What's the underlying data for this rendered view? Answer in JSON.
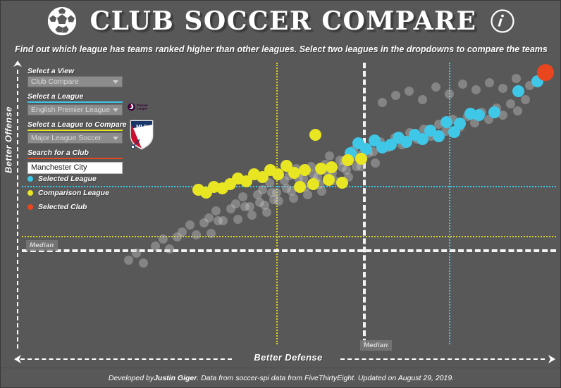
{
  "header": {
    "title": "CLUB SOCCER COMPARE",
    "ball_icon": "soccer-ball-icon",
    "info_icon": "info-icon",
    "subtitle": "Find out which league has teams ranked higher than other leagues. Select two leagues in the dropdowns to compare the teams"
  },
  "controls": {
    "view": {
      "label": "Select a View",
      "value": "Club Compare",
      "underline": "none"
    },
    "league": {
      "label": "Select a League",
      "value": "English Premier League",
      "underline": "#3fc7e8"
    },
    "compare": {
      "label": "Select a League to Compare",
      "value": "Major League Soccer",
      "underline": "#e8e523"
    },
    "search": {
      "label": "Search for a Club",
      "value": "Manchester City",
      "placeholder": "Search for a Club",
      "underline": "#e8461f"
    }
  },
  "logos": {
    "league_logo": "premier-league-logo",
    "compare_logo": "mls-logo"
  },
  "legend": {
    "items": [
      {
        "label": "Selected League",
        "color": "#3fc7e8"
      },
      {
        "label": "Comparison League",
        "color": "#e8e523"
      },
      {
        "label": "Selected Club",
        "color": "#e8461f"
      }
    ]
  },
  "axes": {
    "y_label": "Better Offense",
    "x_label": "Better Defense",
    "y_median_tag": "Median",
    "x_median_tag": "Median"
  },
  "footer": {
    "prefix": "Developed by ",
    "author": "Justin Giger",
    "suffix": ". Data from soccer-spi data from FiveThirtyEight. Updated on August 29, 2019."
  },
  "chart_data": {
    "type": "scatter",
    "title": "CLUB SOCCER COMPARE",
    "xlabel": "Better Defense",
    "ylabel": "Better Offense",
    "xlim": [
      0,
      100
    ],
    "ylim": [
      0,
      100
    ],
    "grid": false,
    "legend_position": "left",
    "medians": {
      "overall_x": 63.8,
      "overall_y": 64.5,
      "selected_league_x": 80.0,
      "selected_league_y": 78.5,
      "comparison_league_x": 47.6,
      "comparison_league_y": 61.0
    },
    "series": [
      {
        "name": "All Clubs",
        "color": "#c8c8c8",
        "points": [
          [
            57.6,
            66.8
          ],
          [
            60.3,
            65.2
          ],
          [
            62.1,
            69.0
          ],
          [
            63.5,
            67.5
          ],
          [
            64.2,
            70.2
          ],
          [
            65.8,
            68.4
          ],
          [
            67.1,
            72.0
          ],
          [
            68.5,
            69.8
          ],
          [
            69.9,
            73.5
          ],
          [
            71.2,
            71.0
          ],
          [
            72.6,
            75.2
          ],
          [
            73.9,
            72.8
          ],
          [
            75.3,
            76.5
          ],
          [
            76.6,
            74.0
          ],
          [
            78.0,
            78.2
          ],
          [
            79.3,
            75.6
          ],
          [
            80.7,
            79.8
          ],
          [
            82.0,
            77.2
          ],
          [
            83.4,
            81.0
          ],
          [
            84.7,
            78.6
          ],
          [
            86.1,
            82.5
          ],
          [
            87.4,
            80.0
          ],
          [
            88.8,
            84.0
          ],
          [
            90.1,
            81.5
          ],
          [
            91.5,
            85.5
          ],
          [
            92.8,
            83.0
          ],
          [
            94.2,
            87.0
          ],
          [
            50.0,
            60.0
          ],
          [
            51.4,
            62.5
          ],
          [
            52.7,
            58.8
          ],
          [
            54.1,
            63.2
          ],
          [
            55.4,
            59.5
          ],
          [
            56.8,
            64.0
          ],
          [
            58.1,
            60.8
          ],
          [
            59.5,
            65.5
          ],
          [
            60.8,
            62.0
          ],
          [
            62.2,
            66.5
          ],
          [
            63.5,
            63.2
          ],
          [
            64.9,
            67.8
          ],
          [
            66.2,
            64.5
          ],
          [
            45.0,
            55.0
          ],
          [
            46.4,
            57.5
          ],
          [
            47.7,
            53.8
          ],
          [
            49.1,
            58.2
          ],
          [
            50.4,
            54.5
          ],
          [
            51.8,
            59.0
          ],
          [
            53.1,
            55.8
          ],
          [
            54.5,
            60.5
          ],
          [
            55.8,
            57.0
          ],
          [
            57.2,
            61.5
          ],
          [
            58.5,
            58.2
          ],
          [
            59.9,
            62.8
          ],
          [
            61.2,
            59.5
          ],
          [
            62.6,
            63.2
          ],
          [
            40.0,
            50.0
          ],
          [
            41.4,
            52.5
          ],
          [
            42.7,
            48.8
          ],
          [
            44.1,
            53.2
          ],
          [
            45.4,
            49.5
          ],
          [
            46.8,
            54.0
          ],
          [
            48.1,
            50.8
          ],
          [
            49.5,
            55.5
          ],
          [
            50.8,
            52.0
          ],
          [
            52.2,
            56.5
          ],
          [
            53.5,
            53.2
          ],
          [
            54.9,
            57.8
          ],
          [
            56.2,
            54.5
          ],
          [
            35.0,
            45.0
          ],
          [
            36.4,
            47.5
          ],
          [
            37.7,
            43.8
          ],
          [
            39.1,
            48.2
          ],
          [
            40.4,
            44.5
          ],
          [
            41.8,
            49.0
          ],
          [
            43.1,
            45.8
          ],
          [
            44.5,
            50.5
          ],
          [
            45.8,
            47.0
          ],
          [
            47.2,
            51.5
          ],
          [
            30.0,
            40.0
          ],
          [
            31.4,
            42.5
          ],
          [
            32.7,
            38.8
          ],
          [
            34.1,
            43.2
          ],
          [
            35.4,
            39.5
          ],
          [
            36.8,
            44.0
          ],
          [
            25.0,
            35.0
          ],
          [
            26.4,
            37.5
          ],
          [
            27.7,
            33.8
          ],
          [
            29.1,
            38.2
          ],
          [
            20.0,
            30.0
          ],
          [
            21.4,
            32.5
          ],
          [
            22.7,
            28.8
          ],
          [
            67.5,
            86.0
          ],
          [
            70.0,
            88.5
          ],
          [
            72.5,
            90.0
          ],
          [
            75.0,
            87.0
          ],
          [
            77.5,
            91.5
          ],
          [
            80.0,
            89.0
          ],
          [
            82.5,
            92.5
          ],
          [
            85.0,
            90.5
          ],
          [
            87.5,
            93.0
          ],
          [
            90.0,
            91.0
          ],
          [
            92.5,
            94.5
          ],
          [
            95.0,
            92.0
          ]
        ]
      },
      {
        "name": "Selected League",
        "color": "#3fc7e8",
        "league": "English Premier League",
        "points": [
          [
            96.5,
            93.5
          ],
          [
            93.0,
            90.0
          ],
          [
            88.5,
            82.5
          ],
          [
            85.5,
            81.5
          ],
          [
            84.0,
            82.0
          ],
          [
            82.0,
            78.5
          ],
          [
            79.5,
            79.0
          ],
          [
            81.0,
            75.5
          ],
          [
            78.0,
            74.0
          ],
          [
            76.5,
            76.0
          ],
          [
            75.0,
            73.0
          ],
          [
            73.5,
            74.5
          ],
          [
            72.0,
            72.0
          ],
          [
            70.5,
            73.5
          ],
          [
            69.0,
            71.0
          ],
          [
            67.5,
            70.0
          ],
          [
            66.0,
            72.5
          ],
          [
            64.5,
            69.5
          ],
          [
            63.0,
            71.5
          ],
          [
            61.5,
            68.0
          ]
        ]
      },
      {
        "name": "Comparison League",
        "color": "#e8e523",
        "league": "Major League Soccer",
        "points": [
          [
            55.0,
            74.5
          ],
          [
            61.0,
            65.5
          ],
          [
            63.5,
            66.0
          ],
          [
            58.0,
            63.0
          ],
          [
            56.0,
            62.5
          ],
          [
            53.0,
            62.0
          ],
          [
            51.0,
            61.0
          ],
          [
            49.5,
            63.5
          ],
          [
            48.0,
            60.5
          ],
          [
            46.5,
            62.0
          ],
          [
            45.0,
            59.5
          ],
          [
            43.5,
            60.5
          ],
          [
            42.0,
            58.0
          ],
          [
            40.5,
            59.0
          ],
          [
            39.0,
            57.0
          ],
          [
            37.5,
            55.5
          ],
          [
            36.0,
            56.0
          ],
          [
            34.5,
            54.0
          ],
          [
            33.0,
            55.0
          ],
          [
            60.0,
            57.5
          ],
          [
            57.5,
            58.5
          ],
          [
            54.5,
            57.0
          ],
          [
            52.0,
            56.0
          ]
        ]
      },
      {
        "name": "Selected Club",
        "color": "#e8461f",
        "club": "Manchester City",
        "points": [
          [
            98.0,
            96.5
          ]
        ]
      }
    ]
  }
}
